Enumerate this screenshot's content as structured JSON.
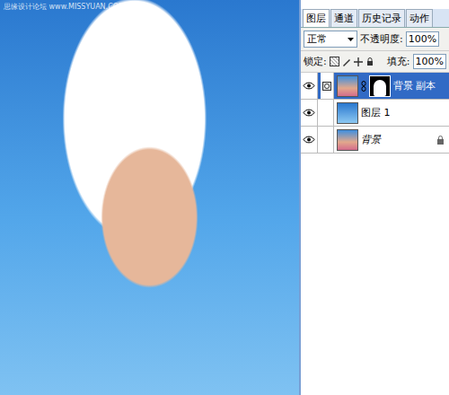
{
  "watermark": "思缘设计论坛 www.MISSYUAN.COM",
  "tabs": [
    {
      "label": "图层",
      "selected": true
    },
    {
      "label": "通道",
      "selected": false
    },
    {
      "label": "历史记录",
      "selected": false
    },
    {
      "label": "动作",
      "selected": false
    }
  ],
  "blend_mode": "正常",
  "opacity": {
    "label": "不透明度:",
    "value": "100%"
  },
  "lock": {
    "label": "锁定:"
  },
  "fill": {
    "label": "填充:",
    "value": "100%"
  },
  "layers": [
    {
      "name": "背景 副本",
      "selected": true,
      "visible": true,
      "has_mask": true,
      "locked": false,
      "italic": false
    },
    {
      "name": "图层 1",
      "selected": false,
      "visible": true,
      "has_mask": false,
      "locked": false,
      "italic": false
    },
    {
      "name": "背景",
      "selected": false,
      "visible": true,
      "has_mask": false,
      "locked": true,
      "italic": true
    }
  ]
}
